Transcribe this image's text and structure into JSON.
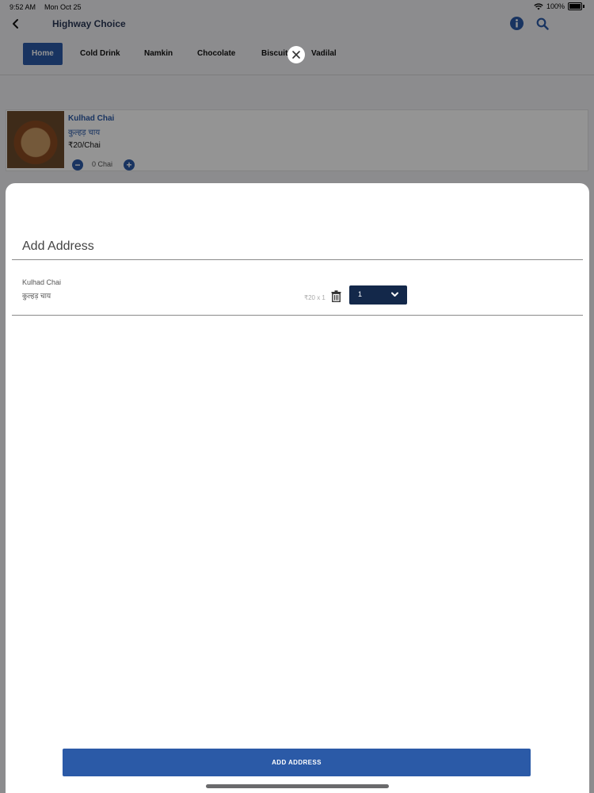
{
  "status_bar": {
    "time": "9:52 AM",
    "date": "Mon Oct 25",
    "battery": "100%"
  },
  "header": {
    "title": "Highway Choice"
  },
  "categories": [
    {
      "label": "Home",
      "active": true
    },
    {
      "label": "Cold Drink",
      "active": false
    },
    {
      "label": "Namkin",
      "active": false
    },
    {
      "label": "Chocolate",
      "active": false
    },
    {
      "label": "Biscuit",
      "active": false
    },
    {
      "label": "Vadilal",
      "active": false
    }
  ],
  "product": {
    "name": "Kulhad Chai",
    "name_hi": "कुल्हड़ चाय",
    "price": "₹20/Chai",
    "qty_text": "0 Chai"
  },
  "sheet": {
    "title": "Add Address",
    "items": [
      {
        "name": "Kulhad Chai",
        "name_hi": "कुल्हड़ चाय",
        "price_qty": "₹20 x 1",
        "quantity": "1"
      }
    ],
    "button_label": "ADD ADDRESS"
  },
  "colors": {
    "primary": "#2b5aa7",
    "dark_navy": "#13284a"
  }
}
